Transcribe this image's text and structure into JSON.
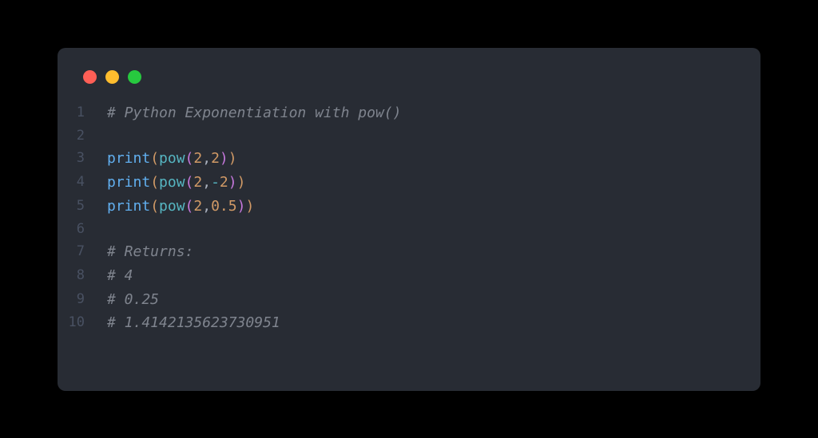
{
  "lines": [
    {
      "no": "1",
      "tokens": [
        {
          "cls": "comment",
          "t": "# Python Exponentiation with pow()"
        }
      ]
    },
    {
      "no": "2",
      "tokens": []
    },
    {
      "no": "3",
      "tokens": [
        {
          "cls": "func",
          "t": "print"
        },
        {
          "cls": "paren",
          "t": "("
        },
        {
          "cls": "builtin",
          "t": "pow"
        },
        {
          "cls": "paren2",
          "t": "("
        },
        {
          "cls": "number",
          "t": "2"
        },
        {
          "cls": "comma",
          "t": ","
        },
        {
          "cls": "number",
          "t": "2"
        },
        {
          "cls": "paren2",
          "t": ")"
        },
        {
          "cls": "paren",
          "t": ")"
        }
      ]
    },
    {
      "no": "4",
      "tokens": [
        {
          "cls": "func",
          "t": "print"
        },
        {
          "cls": "paren",
          "t": "("
        },
        {
          "cls": "builtin",
          "t": "pow"
        },
        {
          "cls": "paren2",
          "t": "("
        },
        {
          "cls": "number",
          "t": "2"
        },
        {
          "cls": "comma",
          "t": ","
        },
        {
          "cls": "op",
          "t": "-"
        },
        {
          "cls": "number",
          "t": "2"
        },
        {
          "cls": "paren2",
          "t": ")"
        },
        {
          "cls": "paren",
          "t": ")"
        }
      ]
    },
    {
      "no": "5",
      "tokens": [
        {
          "cls": "func",
          "t": "print"
        },
        {
          "cls": "paren",
          "t": "("
        },
        {
          "cls": "builtin",
          "t": "pow"
        },
        {
          "cls": "paren2",
          "t": "("
        },
        {
          "cls": "number",
          "t": "2"
        },
        {
          "cls": "comma",
          "t": ","
        },
        {
          "cls": "number",
          "t": "0.5"
        },
        {
          "cls": "paren2",
          "t": ")"
        },
        {
          "cls": "paren",
          "t": ")"
        }
      ]
    },
    {
      "no": "6",
      "tokens": []
    },
    {
      "no": "7",
      "tokens": [
        {
          "cls": "comment",
          "t": "# Returns:"
        }
      ]
    },
    {
      "no": "8",
      "tokens": [
        {
          "cls": "comment",
          "t": "# 4"
        }
      ]
    },
    {
      "no": "9",
      "tokens": [
        {
          "cls": "comment",
          "t": "# 0.25"
        }
      ]
    },
    {
      "no": "10",
      "tokens": [
        {
          "cls": "comment",
          "t": "# 1.4142135623730951"
        }
      ]
    }
  ]
}
